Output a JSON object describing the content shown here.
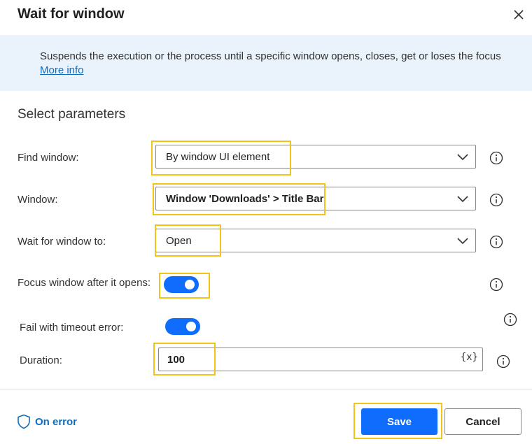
{
  "dialog": {
    "title": "Wait for window",
    "close_icon": "close-icon"
  },
  "banner": {
    "description": "Suspends the execution or the process until a specific window opens, closes, get or loses the focus",
    "more_info": "More info"
  },
  "section": {
    "title": "Select parameters"
  },
  "params": {
    "find_window": {
      "label": "Find window:",
      "value": "By window UI element"
    },
    "window": {
      "label": "Window:",
      "value": "Window 'Downloads' > Title Bar"
    },
    "wait_for": {
      "label": "Wait for window to:",
      "value": "Open"
    },
    "focus_window": {
      "label": "Focus window after it opens:",
      "enabled": true
    },
    "fail_timeout": {
      "label": "Fail with timeout error:",
      "enabled": true
    },
    "duration": {
      "label": "Duration:",
      "value": "100",
      "variable_button": "{x}"
    }
  },
  "footer": {
    "on_error": "On error",
    "save": "Save",
    "cancel": "Cancel"
  },
  "colors": {
    "accent": "#0f6cfd",
    "link": "#0f6cbd",
    "banner_bg": "#eaf3fc",
    "highlight": "#f2c319"
  }
}
